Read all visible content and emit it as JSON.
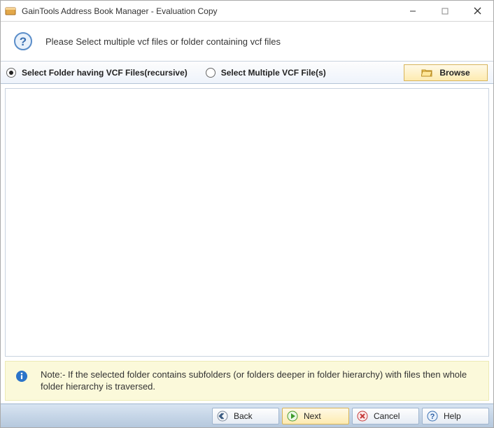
{
  "window": {
    "title": "GainTools Address Book Manager - Evaluation Copy"
  },
  "header": {
    "instruction": "Please Select multiple vcf files or folder containing vcf files"
  },
  "options": {
    "folder_recursive_label": "Select Folder having VCF Files(recursive)",
    "multiple_files_label": "Select Multiple VCF File(s)",
    "selected": "folder_recursive",
    "browse_label": "Browse"
  },
  "note": {
    "prefix": "Note:- ",
    "text": "If the selected folder contains subfolders (or folders deeper in folder hierarchy) with files then whole folder hierarchy is traversed."
  },
  "buttons": {
    "back": "Back",
    "next": "Next",
    "cancel": "Cancel",
    "help": "Help"
  },
  "colors": {
    "highlight_bg": "#fdebb0",
    "note_bg": "#fbf9da"
  }
}
